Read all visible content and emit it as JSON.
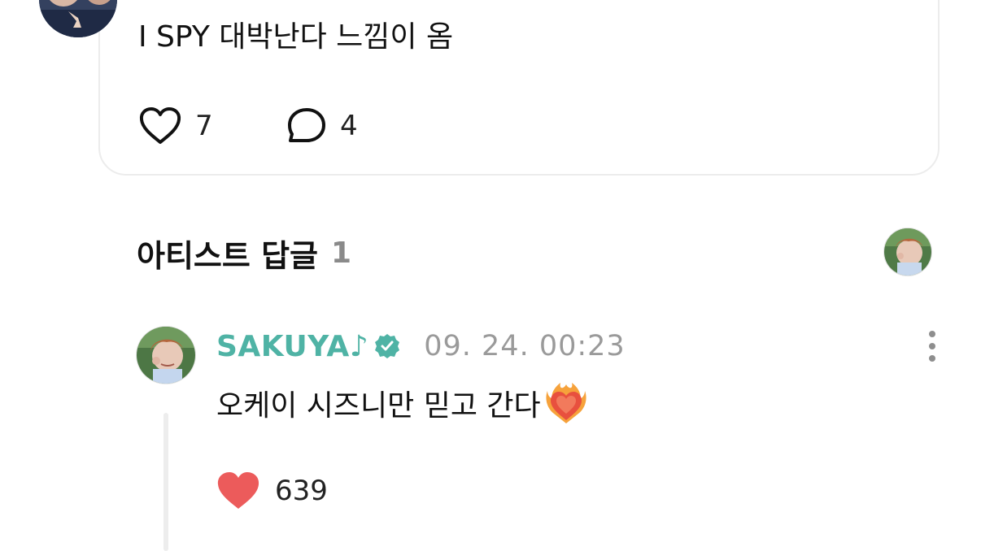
{
  "post": {
    "text": "I SPY 대박난다 느낌이 옴",
    "like_count": "7",
    "comment_count": "4",
    "like_icon": "heart-outline-icon",
    "comment_icon": "speech-bubble-outline-icon"
  },
  "artist_replies": {
    "title": "아티스트 답글",
    "count": "1"
  },
  "reply": {
    "author": "SAKUYA♪",
    "verified_icon": "verified-badge-icon",
    "timestamp": "09. 24. 00:23",
    "text": "오케이 시즈니만 믿고 간다",
    "emoji": "heart-on-fire",
    "like_count": "639",
    "like_icon": "heart-filled-icon",
    "more_icon": "more-vertical-icon"
  },
  "colors": {
    "author": "#4fb3a5",
    "verified": "#4fb3a5",
    "liked_heart": "#ec5b5b",
    "timestamp": "#9a9a9a",
    "reply_count": "#8a8a8a"
  }
}
